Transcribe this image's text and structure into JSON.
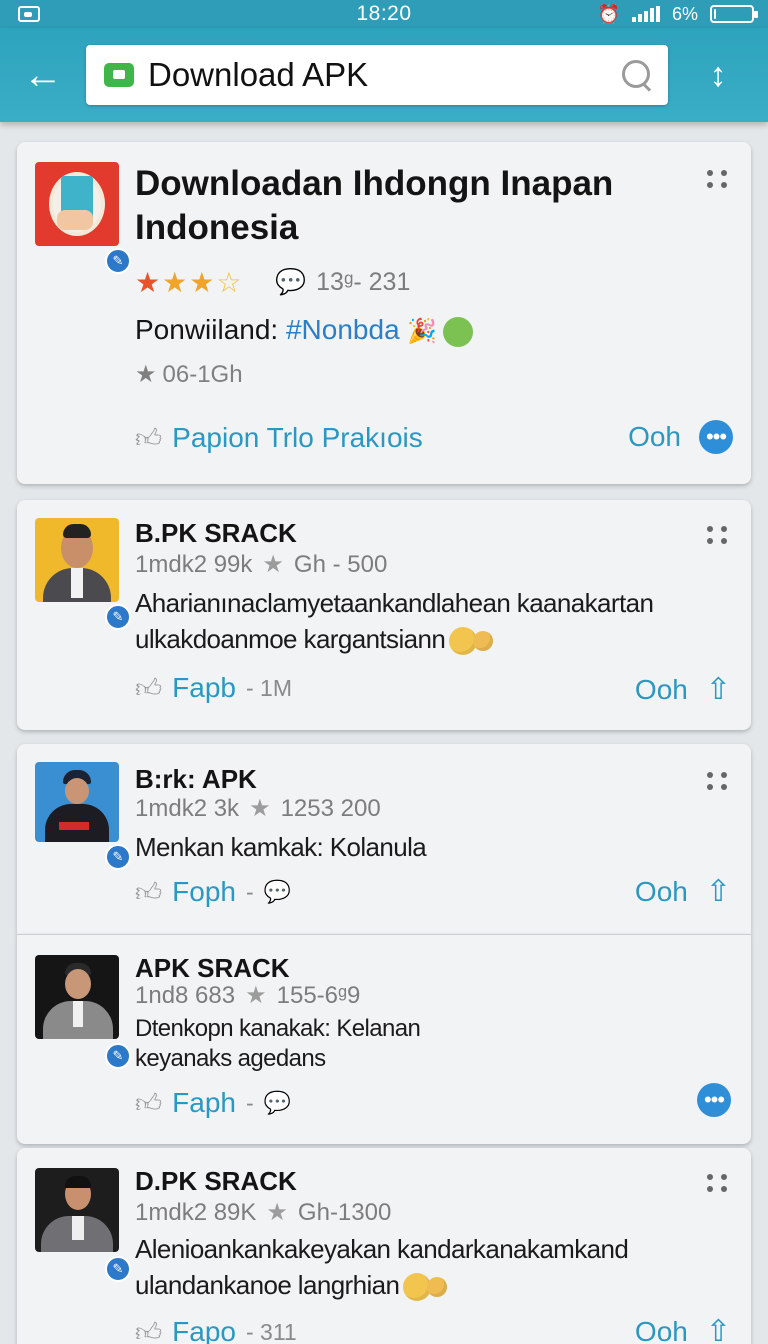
{
  "status_bar": {
    "time": "18:20",
    "battery_text": "6%",
    "battery_level": 0.06
  },
  "app_bar": {
    "back_icon": "arrow-left-icon",
    "search_text": "Download APK",
    "search_icon": "search-icon",
    "sort_icon": "sort-icon"
  },
  "featured": {
    "title_line1": "Downloadan Ihdongn Inapan",
    "title_line2": "Indonesia",
    "rating_stars": 3.5,
    "comments": "13ᵍ- 231",
    "developer_label": "Ponwiiland:",
    "developer_tag": "#Nonbda",
    "size": "06-1Gh",
    "action_label": "Papion Trlo Prakıois",
    "right_label": "Ooh",
    "colors": {
      "accent": "#2b98c2",
      "star": "#f0a52a",
      "icon_bg": "#e0312a"
    }
  },
  "posts": [
    {
      "title": "B.PK SRACK",
      "stat": "1mdk2 99k",
      "stat2": "Gh - 500",
      "desc_line1": "Aharianınaclamyetaankandlahean kaanakartan",
      "desc_line2": "ulkakdoanmoe kargantsiann",
      "action_label": "Fapb",
      "action_count": "- 1M",
      "right_label": "Ooh",
      "avatar_bg": "#f0b92c"
    },
    {
      "title": "B:rk: APK",
      "stat": "1mdk2 3k",
      "stat2": "1253 200",
      "desc_line1": "Menkan kamkak: Kolanula",
      "desc_line2": "",
      "action_label": "Foph",
      "action_count": "-",
      "right_label": "Ooh",
      "avatar_bg": "#3a8fd2"
    },
    {
      "title": "APK SRACK",
      "stat": "1nd8 683",
      "stat2": "155-6ᵍ9",
      "desc_line1": "Dtenkopn kanakak: Kelanan",
      "desc_line2": "keyanaks agedans",
      "action_label": "Faph",
      "action_count": "-",
      "right_label": "",
      "avatar_bg": "#151515"
    },
    {
      "title": "D.PK SRACK",
      "stat": "1mdk2 89K",
      "stat2": "Gh-1300",
      "desc_line1": "Alenioankankakeyakan kandarkanakamkand",
      "desc_line2": "ulandankanoe langrhian",
      "action_label": "Fapo",
      "action_count": "- 311",
      "right_label": "Ooh",
      "avatar_bg": "#1d1d1d"
    }
  ]
}
